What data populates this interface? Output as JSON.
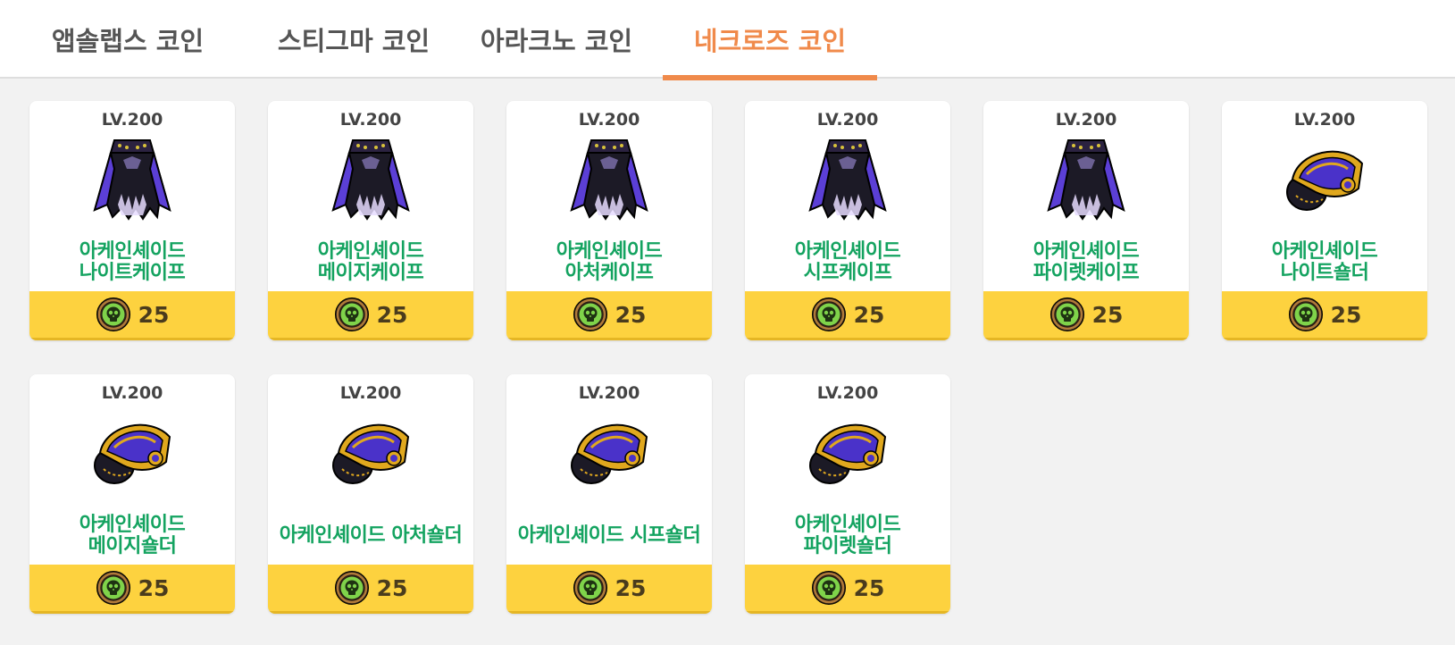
{
  "tabs": [
    {
      "label": "앱솔랩스 코인",
      "active": false
    },
    {
      "label": "스티그마 코인",
      "active": false
    },
    {
      "label": "아라크노 코인",
      "active": false
    },
    {
      "label": "네크로즈 코인",
      "active": true
    }
  ],
  "colors": {
    "accent": "#f08a4b",
    "item_name": "#14a360",
    "price_bar": "#fdd23f",
    "background": "#f2f2f2"
  },
  "items": [
    {
      "level": "LV.200",
      "name_line1": "아케인셰이드",
      "name_line2": "나이트케이프",
      "icon": "cape-icon",
      "price": "25",
      "currency_icon": "skull-coin-icon"
    },
    {
      "level": "LV.200",
      "name_line1": "아케인셰이드",
      "name_line2": "메이지케이프",
      "icon": "cape-icon",
      "price": "25",
      "currency_icon": "skull-coin-icon"
    },
    {
      "level": "LV.200",
      "name_line1": "아케인셰이드",
      "name_line2": "아처케이프",
      "icon": "cape-icon",
      "price": "25",
      "currency_icon": "skull-coin-icon"
    },
    {
      "level": "LV.200",
      "name_line1": "아케인셰이드",
      "name_line2": "시프케이프",
      "icon": "cape-icon",
      "price": "25",
      "currency_icon": "skull-coin-icon"
    },
    {
      "level": "LV.200",
      "name_line1": "아케인셰이드",
      "name_line2": "파이렛케이프",
      "icon": "cape-icon",
      "price": "25",
      "currency_icon": "skull-coin-icon"
    },
    {
      "level": "LV.200",
      "name_line1": "아케인셰이드",
      "name_line2": "나이트숄더",
      "icon": "shoulder-icon",
      "price": "25",
      "currency_icon": "skull-coin-icon"
    },
    {
      "level": "LV.200",
      "name_line1": "아케인셰이드",
      "name_line2": "메이지숄더",
      "icon": "shoulder-icon",
      "price": "25",
      "currency_icon": "skull-coin-icon"
    },
    {
      "level": "LV.200",
      "name_line1": "아케인셰이드 아처숄더",
      "name_line2": "",
      "icon": "shoulder-icon",
      "price": "25",
      "currency_icon": "skull-coin-icon"
    },
    {
      "level": "LV.200",
      "name_line1": "아케인셰이드 시프숄더",
      "name_line2": "",
      "icon": "shoulder-icon",
      "price": "25",
      "currency_icon": "skull-coin-icon"
    },
    {
      "level": "LV.200",
      "name_line1": "아케인셰이드",
      "name_line2": "파이렛숄더",
      "icon": "shoulder-icon",
      "price": "25",
      "currency_icon": "skull-coin-icon"
    }
  ]
}
